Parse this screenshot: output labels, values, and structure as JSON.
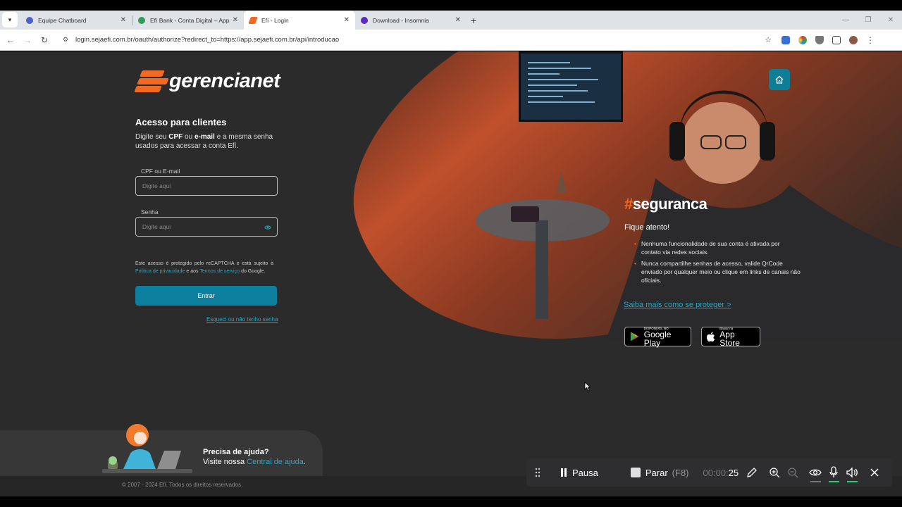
{
  "browser": {
    "tabs": [
      {
        "title": "Equipe Chatboard",
        "color": "#4a63c8",
        "active": false
      },
      {
        "title": "Efí Bank - Conta Digital – Apps",
        "color": "#2e9d5b",
        "active": false
      },
      {
        "title": "Efí - Login",
        "color": "#f26a21",
        "active": true
      },
      {
        "title": "Download - Insomnia",
        "color": "#5b2bbf",
        "active": false
      }
    ],
    "url": "login.sejaefi.com.br/oauth/authorize?redirect_to=https://app.sejaefi.com.br/api/introducao"
  },
  "brand": {
    "name": "gerencianet",
    "accent": "#f26a21",
    "primary": "#0b7f9d",
    "link": "#2ba6c2"
  },
  "login": {
    "title": "Acesso para clientes",
    "desc_before": "Digite seu ",
    "desc_cpf": "CPF",
    "desc_or": " ou ",
    "desc_email": "e-mail",
    "desc_after": " e a mesma senha usados para acessar a conta Efí.",
    "cpf_label": "CPF ou E-mail",
    "cpf_placeholder": "Digite aqui",
    "password_label": "Senha",
    "password_placeholder": "Digite aqui",
    "recaptcha_text": "Este acesso é protegido pelo reCAPTCHA e está sujeito à ",
    "privacy_link": "Política de privacidade",
    "recaptcha_and": " e aos ",
    "terms_link": "Termos de serviço",
    "recaptcha_end": " do Google.",
    "submit": "Entrar",
    "forgot": "Esqueci ou não tenho senha"
  },
  "security": {
    "hashtag_symbol": "#",
    "hashtag_word": "seguranca",
    "attention": "Fique atento!",
    "tips": [
      "Nenhuma funcionalidade de sua conta é ativada por contato via redes sociais.",
      "Nunca compartilhe senhas de acesso, valide QrCode enviado por qualquer meio ou clique em links de canais não oficiais."
    ],
    "learn_more": "Saiba mais como se proteger >"
  },
  "stores": {
    "google_small": "DISPONÍVEL NO",
    "google_big": "Google Play",
    "apple_small": "Baixar na",
    "apple_big": "App Store"
  },
  "help": {
    "title": "Precisa de ajuda?",
    "prefix": "Visite nossa ",
    "link": "Central de ajuda",
    "suffix": "."
  },
  "footer": {
    "copyright": "© 2007 - 2024 Efí. Todos os direitos reservados."
  },
  "recorder": {
    "pause": "Pausa",
    "stop": "Parar",
    "stop_key": "(F8)",
    "timer_dim": "00:00:",
    "timer_sec": "25"
  }
}
